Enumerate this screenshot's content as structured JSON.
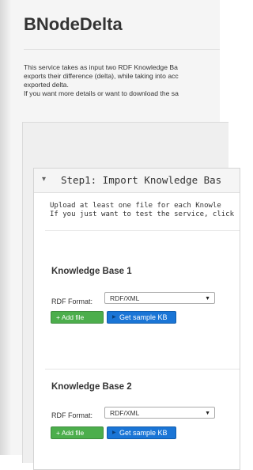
{
  "app": {
    "title": "BNodeDelta"
  },
  "description": {
    "lines": [
      "This service takes as input two RDF Knowledge Ba",
      "exports their difference (delta), while taking into acc",
      "exported delta.",
      "If you want more details or want to download the sa"
    ]
  },
  "step1": {
    "title": "Step1: Import Knowledge Bas",
    "intro_lines": [
      "Upload at least one file for each Knowle",
      "If you just want to test the service, click"
    ]
  },
  "kb1": {
    "title": "Knowledge Base 1",
    "format_label": "RDF Format:",
    "format_value": "RDF/XML",
    "add_file": "+ Add file",
    "sample": "Get sample KB"
  },
  "kb2": {
    "title": "Knowledge Base 2",
    "format_label": "RDF Format:",
    "format_value": "RDF/XML",
    "add_file": "+ Add file",
    "sample": "Get sample KB"
  },
  "colors": {
    "green": "#4cae4c",
    "blue": "#1a75d6"
  },
  "icons": {
    "collapse": "caret-down-icon",
    "select_arrow": "triangle-down-icon",
    "sample_caret": "caret-right-icon"
  }
}
